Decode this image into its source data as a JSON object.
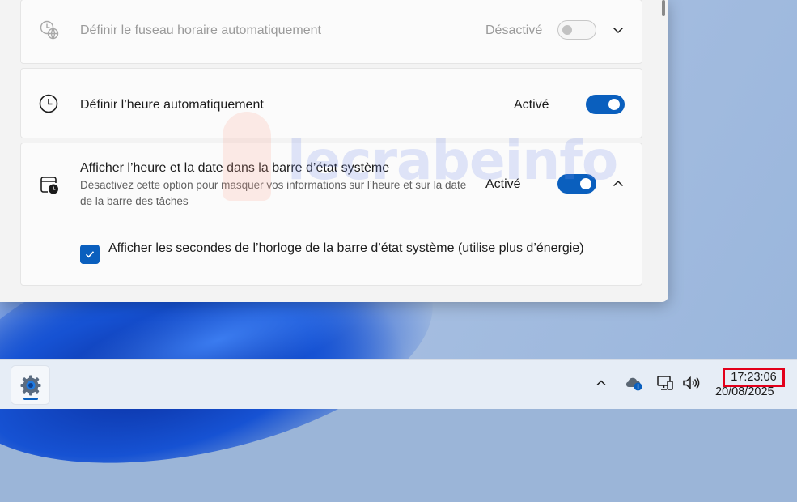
{
  "settings": {
    "timezone": {
      "title": "Définir le fuseau horaire automatiquement",
      "state": "Désactivé",
      "icon": "timezone-globe-icon",
      "enabled": false
    },
    "auto_time": {
      "title": "Définir l’heure automatiquement",
      "state": "Activé",
      "icon": "clock-icon",
      "enabled": true
    },
    "tray_clock": {
      "title": "Afficher l’heure et la date dans la barre d’état système",
      "subtitle": "Désactivez cette option pour masquer vos informations sur l’heure et sur la date de la barre des tâches",
      "state": "Activé",
      "icon": "calendar-clock-icon",
      "enabled": true,
      "expanded": true
    },
    "show_seconds": {
      "label": "Afficher les secondes de l’horloge de la barre d’état système (utilise plus d’énergie)",
      "checked": true
    }
  },
  "watermark": "lecrabeinfo",
  "taskbar": {
    "pinned_app": "settings-gear-icon",
    "tray_icons": [
      "chevron-up-icon",
      "onedrive-cloud-icon",
      "network-icon",
      "volume-icon"
    ],
    "time": "17:23:06",
    "date": "20/08/2025"
  },
  "colors": {
    "accent": "#0a5fbe",
    "highlight_box": "#e3001b"
  }
}
